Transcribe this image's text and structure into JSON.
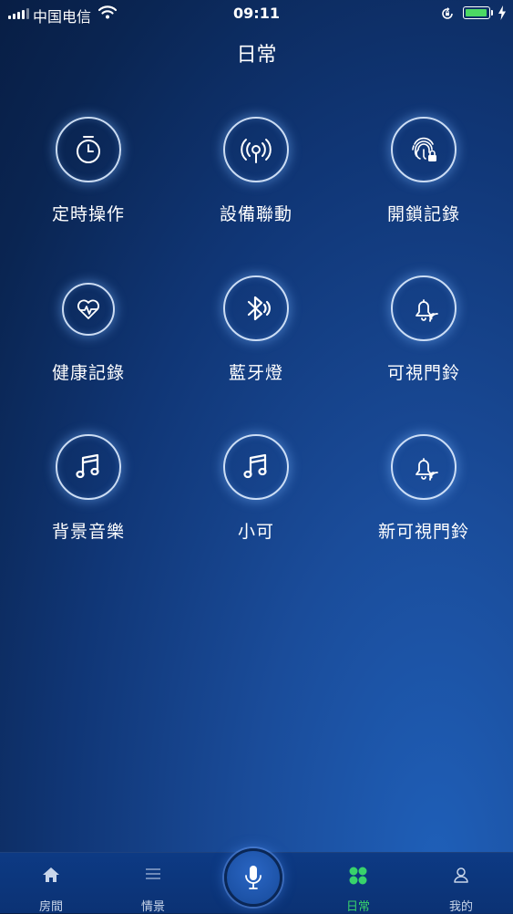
{
  "status_bar": {
    "carrier": "中国电信",
    "time": "09:11",
    "battery_level": 1.0,
    "battery_color": "#4cd964"
  },
  "page": {
    "title": "日常"
  },
  "grid": {
    "items": [
      {
        "label": "定時操作",
        "icon": "timer-icon"
      },
      {
        "label": "設備聯動",
        "icon": "device-link-icon"
      },
      {
        "label": "開鎖記錄",
        "icon": "fingerprint-lock-icon"
      },
      {
        "label": "健康記錄",
        "icon": "heart-pulse-icon"
      },
      {
        "label": "藍牙燈",
        "icon": "bluetooth-icon"
      },
      {
        "label": "可視門鈴",
        "icon": "doorbell-icon"
      },
      {
        "label": "背景音樂",
        "icon": "music-note-icon"
      },
      {
        "label": "小可",
        "icon": "music-note-icon"
      },
      {
        "label": "新可視門鈴",
        "icon": "doorbell-icon"
      }
    ]
  },
  "tabbar": {
    "active_color": "#38d36b",
    "tabs": [
      {
        "label": "房間",
        "icon": "home-icon"
      },
      {
        "label": "情景",
        "icon": "menu-lines-icon"
      },
      {
        "label": "日常",
        "icon": "four-leaf-grid-icon",
        "active": true
      },
      {
        "label": "我的",
        "icon": "user-icon"
      }
    ],
    "center_button": {
      "icon": "microphone-icon"
    }
  }
}
